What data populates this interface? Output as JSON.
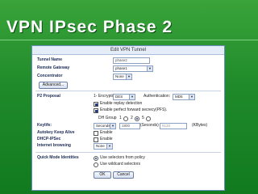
{
  "slide": {
    "title": "VPN IPsec Phase 2"
  },
  "dialog": {
    "title": "Edit VPN Tunnel",
    "tunnel_name": {
      "label": "Tunnel Name",
      "value": "phase2"
    },
    "remote_gateway": {
      "label": "Remote Gateway",
      "value": "phase1"
    },
    "concentrator": {
      "label": "Concentrator",
      "value": "None"
    },
    "advanced_button": "Advanced...",
    "p2_proposal": {
      "label": "P2 Proposal",
      "encryption_label": "1- Encryption:",
      "encryption_value": "DES",
      "auth_label": "Authentication:",
      "auth_value": "MD5"
    },
    "replay": {
      "label": "Enable replay detection",
      "checked": true
    },
    "pfs": {
      "label": "Enable perfect forward secrecy(PFS).",
      "checked": true
    },
    "dh_group": {
      "label": "DH Group",
      "options": [
        "1",
        "2",
        "5"
      ],
      "selected": "2"
    },
    "keylife": {
      "label": "Keylife:",
      "unit": "Seconds",
      "seconds_value": "1800",
      "seconds_label": "(Seconds)",
      "kbytes_value": "5120",
      "kbytes_label": "(KBytes)"
    },
    "autokey_keep_alive": {
      "label": "Autokey Keep Alive",
      "option": "Enable"
    },
    "dhcp_ipsec": {
      "label": "DHCP-IPSec",
      "option": "Enable"
    },
    "internet_browsing": {
      "label": "Internet browsing",
      "value": "None"
    },
    "quick_mode": {
      "label": "Quick Mode Identities",
      "option_policy": "Use selectors from policy",
      "option_wildcard": "Use wildcard selectors",
      "selected": "policy"
    },
    "ok_button": "OK",
    "cancel_button": "Cancel"
  }
}
